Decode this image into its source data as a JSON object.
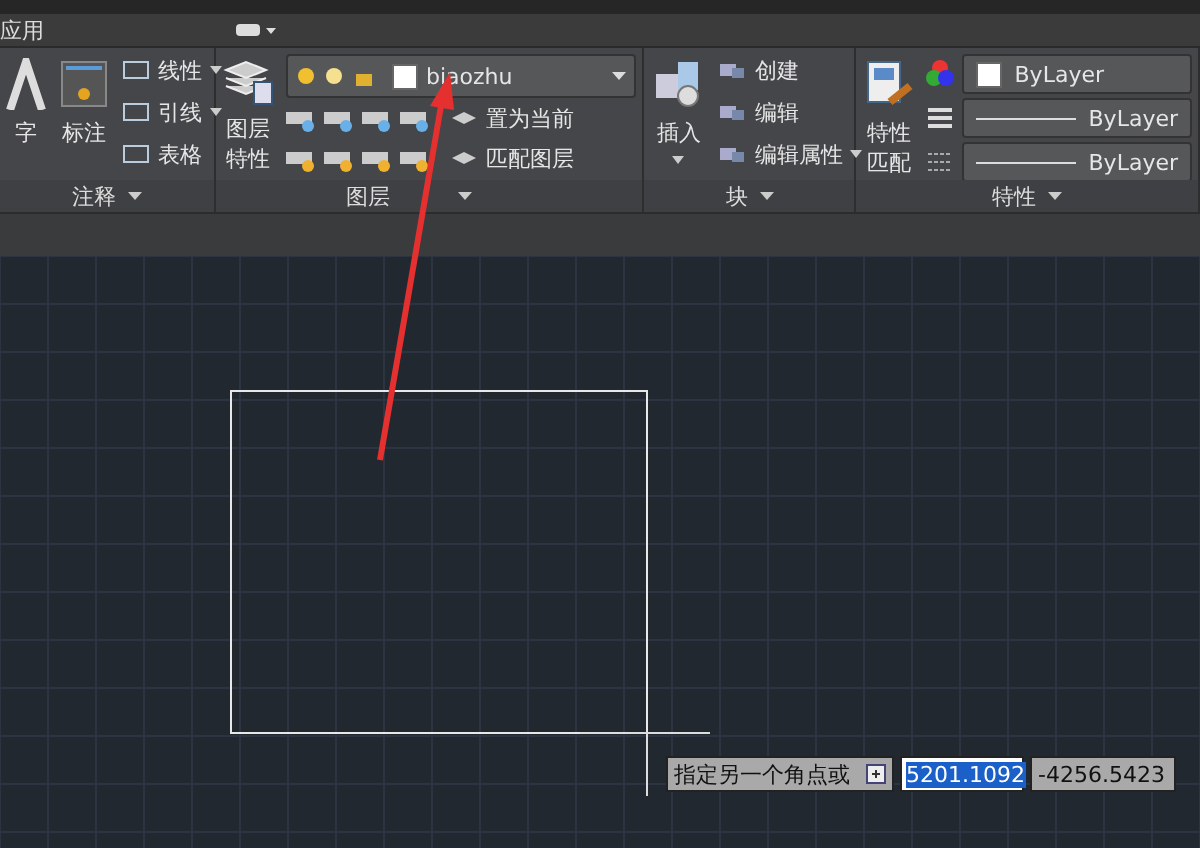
{
  "tab_row": {
    "label": "应用"
  },
  "annotation_panel": {
    "title": "注释",
    "large_tools": [
      "字",
      "标注"
    ],
    "small_tools": [
      {
        "label": "线性",
        "dropdown": true
      },
      {
        "label": "引线",
        "dropdown": true
      },
      {
        "label": "表格",
        "dropdown": false
      }
    ]
  },
  "layers_panel": {
    "title": "图层",
    "properties_button": [
      "图层",
      "特性"
    ],
    "layer_dropdown": {
      "name": "biaozhu"
    },
    "buttons": [
      "置为当前",
      "匹配图层"
    ]
  },
  "block_panel": {
    "title": "块",
    "insert_button": "插入",
    "items": [
      {
        "label": "创建",
        "dropdown": false
      },
      {
        "label": "编辑",
        "dropdown": false
      },
      {
        "label": "编辑属性",
        "dropdown": true
      }
    ]
  },
  "properties_panel": {
    "title": "特性",
    "match_button": [
      "特性",
      "匹配"
    ],
    "color_setting": "ByLayer",
    "linetype": "ByLayer",
    "lineweight": "ByLayer"
  },
  "dynamic_input": {
    "prompt": "指定另一个角点或",
    "x_value": "5201.1092",
    "y_value": "-4256.5423"
  }
}
